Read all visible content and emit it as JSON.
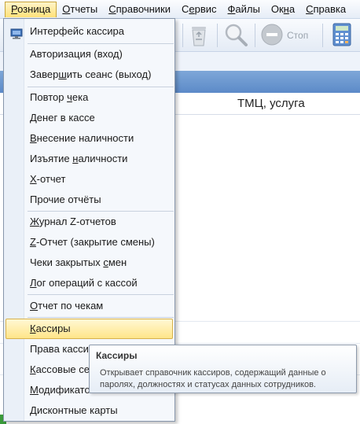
{
  "menubar": {
    "items": [
      {
        "pre": "",
        "mn": "Р",
        "post": "озница"
      },
      {
        "pre": "",
        "mn": "О",
        "post": "тчеты"
      },
      {
        "pre": "",
        "mn": "С",
        "post": "правочники"
      },
      {
        "pre": "С",
        "mn": "е",
        "post": "рвис"
      },
      {
        "pre": "",
        "mn": "Ф",
        "post": "айлы"
      },
      {
        "pre": "Ок",
        "mn": "н",
        "post": "а"
      },
      {
        "pre": "",
        "mn": "С",
        "post": "правка"
      }
    ]
  },
  "toolbar": {
    "stop_label": "Стоп"
  },
  "grid": {
    "column_header": "ТМЦ, услуга"
  },
  "dropdown": {
    "items": [
      {
        "pre": "",
        "mn": "",
        "post": "Интерфейс кассира"
      },
      {
        "pre": "Авторизация (вход)",
        "mn": "",
        "post": ""
      },
      {
        "pre": "Завер",
        "mn": "ш",
        "post": "ить сеанс (выход)"
      },
      {
        "pre": "Повтор ",
        "mn": "ч",
        "post": "ека"
      },
      {
        "pre": "Денег в кассе",
        "mn": "",
        "post": ""
      },
      {
        "pre": "",
        "mn": "В",
        "post": "несение наличности"
      },
      {
        "pre": "Изъятие ",
        "mn": "н",
        "post": "аличности"
      },
      {
        "pre": "",
        "mn": "Х",
        "post": "-отчет"
      },
      {
        "pre": "Прочие отчёты",
        "mn": "",
        "post": ""
      },
      {
        "pre": "",
        "mn": "Ж",
        "post": "урнал Z-отчетов"
      },
      {
        "pre": "",
        "mn": "Z",
        "post": "-Отчет (закрытие смены)"
      },
      {
        "pre": "Чеки закрытых ",
        "mn": "с",
        "post": "мен"
      },
      {
        "pre": "",
        "mn": "Л",
        "post": "ог операций с кассой"
      },
      {
        "pre": "",
        "mn": "О",
        "post": "тчет по чекам"
      },
      {
        "pre": "",
        "mn": "К",
        "post": "ассиры"
      },
      {
        "pre": "Права касси",
        "mn": "",
        "post": ""
      },
      {
        "pre": "",
        "mn": "К",
        "post": "ассовые се"
      },
      {
        "pre": "",
        "mn": "М",
        "post": "одификато"
      },
      {
        "pre": "",
        "mn": "Д",
        "post": "исконтные карты"
      }
    ]
  },
  "tooltip": {
    "title": "Кассиры",
    "line1": "Открывает справочник кассиров, содержащий данные о",
    "line2": "паролях, должностях и статусах данных сотрудников."
  }
}
